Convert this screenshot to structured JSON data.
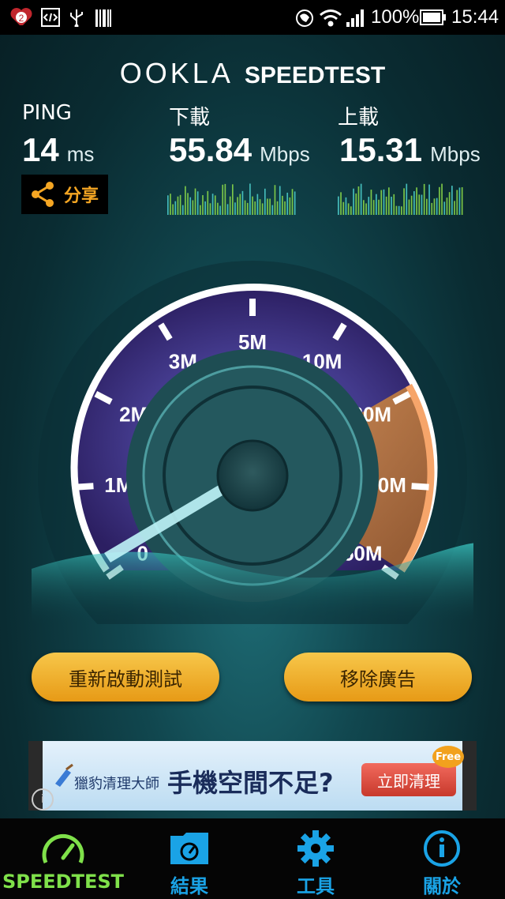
{
  "status_bar": {
    "notification_badge": "2",
    "battery_percent": "100%",
    "time": "15:44"
  },
  "header": {
    "logo_left": "OOKLA",
    "logo_right": "SPEEDTEST"
  },
  "stats": {
    "ping": {
      "label": "PING",
      "value": "14",
      "unit": "ms"
    },
    "download": {
      "label": "下載",
      "value": "55.84",
      "unit": "Mbps"
    },
    "upload": {
      "label": "上載",
      "value": "15.31",
      "unit": "Mbps"
    },
    "share_label": "分享"
  },
  "gauge": {
    "ticks": [
      "0",
      "1M",
      "2M",
      "3M",
      "5M",
      "10M",
      "20M",
      "30M",
      "50M"
    ],
    "needle_value_fraction": 0.0
  },
  "buttons": {
    "restart_test": "重新啟動測試",
    "remove_ads": "移除廣告"
  },
  "ad": {
    "brand": "獵豹清理大師",
    "headline": "手機空間不足?",
    "cta": "立即清理",
    "badge": "Free",
    "info_glyph": "i"
  },
  "nav": {
    "items": [
      {
        "label": "SPEEDTEST",
        "icon": "speedometer-icon",
        "active": true
      },
      {
        "label": "結果",
        "icon": "folder-results-icon",
        "active": false
      },
      {
        "label": "工具",
        "icon": "gear-icon",
        "active": false
      },
      {
        "label": "關於",
        "icon": "info-icon",
        "active": false
      }
    ]
  },
  "colors": {
    "accent_green": "#7fe14a",
    "nav_blue": "#1aa3e6",
    "button_gold": "#f0b030",
    "share_orange": "#f5a623"
  }
}
